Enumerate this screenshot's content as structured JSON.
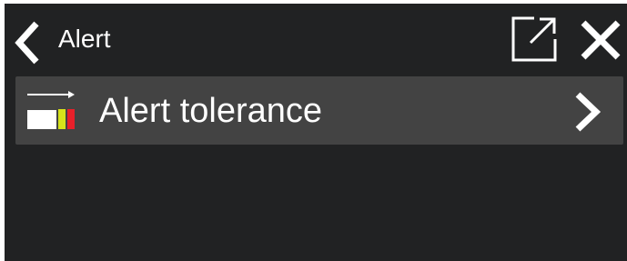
{
  "header": {
    "title": "Alert",
    "back_icon": "chevron-left-icon",
    "popout_icon": "external-link-icon",
    "close_icon": "close-icon"
  },
  "list": {
    "items": [
      {
        "label": "Alert tolerance",
        "icon": "tolerance-gauge-icon",
        "trailing_icon": "chevron-right-icon"
      }
    ]
  },
  "colors": {
    "background": "#212223",
    "row_background": "#434343",
    "text": "#ffffff",
    "icon_yellow": "#d7e31a",
    "icon_red": "#e8202a"
  }
}
